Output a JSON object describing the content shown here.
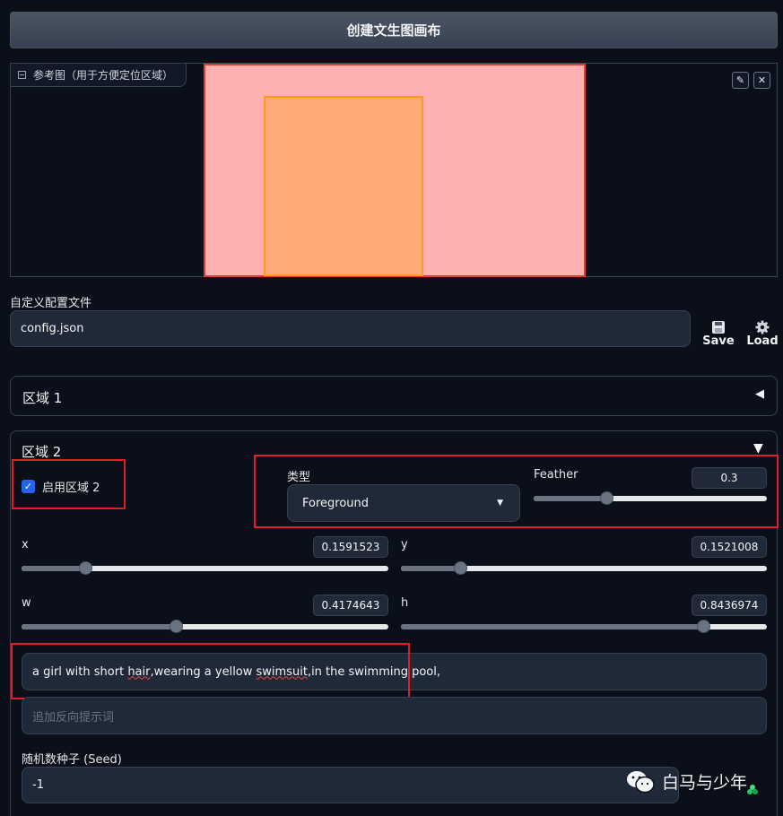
{
  "create_button": "创建文生图画布",
  "canvas": {
    "label": "参考图（用于方便定位区域）",
    "edit_icon": "pencil-icon",
    "close_icon": "close-icon",
    "region1_color": "#ffb0b0",
    "region2_color": "#ffaa77"
  },
  "config": {
    "label": "自定义配置文件",
    "value": "config.json",
    "save_label": "Save",
    "load_label": "Load"
  },
  "region1": {
    "title": "区域 1",
    "toggle": "◀"
  },
  "region2": {
    "title": "区域 2",
    "toggle": "▼",
    "enable_label": "启用区域 2",
    "enabled": true,
    "type_label": "类型",
    "type_value": "Foreground",
    "feather_label": "Feather",
    "feather_value": "0.3",
    "x_label": "x",
    "x_value": "0.1591523",
    "y_label": "y",
    "y_value": "0.1521008",
    "w_label": "w",
    "w_value": "0.4174643",
    "h_label": "h",
    "h_value": "0.8436974",
    "prompt_parts": [
      "a girl with short ",
      "hair",
      ",wearing a yellow ",
      "swimsuit",
      ",in the swimming pool,"
    ],
    "negative_placeholder": "追加反向提示词",
    "seed_label": "随机数种子 (Seed)",
    "seed_value": "-1"
  },
  "watermark": "白马与少年",
  "accent": "#2563eb",
  "highlight": "#e11d2a"
}
